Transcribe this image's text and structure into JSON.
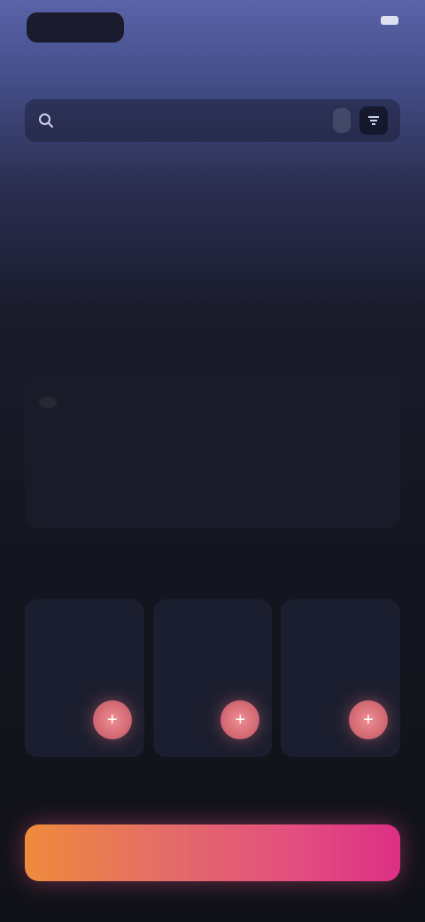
{
  "status_bar": {
    "pill_label": "",
    "right_text": ""
  },
  "header": {
    "title": ""
  },
  "search": {
    "placeholder": "",
    "chip_label": ""
  },
  "about": {
    "label": "",
    "text": ""
  },
  "details": {
    "label": "",
    "tabs": [
      {
        "label": ""
      },
      {
        "label": ""
      },
      {
        "label": ""
      },
      {
        "label": ""
      }
    ],
    "sub_label": "",
    "description": ""
  },
  "recommendations": {
    "label": "",
    "cards": [
      {
        "title": "",
        "meta": ""
      },
      {
        "title": "",
        "meta": ""
      },
      {
        "title": "",
        "meta": ""
      }
    ]
  },
  "cta": {
    "label": ""
  },
  "colors": {
    "background_top": "#5a63a8",
    "background_bottom": "#111218",
    "card_bg": "#1b1e2e",
    "accent_orange": "#ef8b3c",
    "accent_pink": "#dd2f86",
    "action_circle": "#e07a82"
  },
  "icons": {
    "search": "search-icon",
    "filter": "filter-icon",
    "card_action": "plus-icon"
  }
}
